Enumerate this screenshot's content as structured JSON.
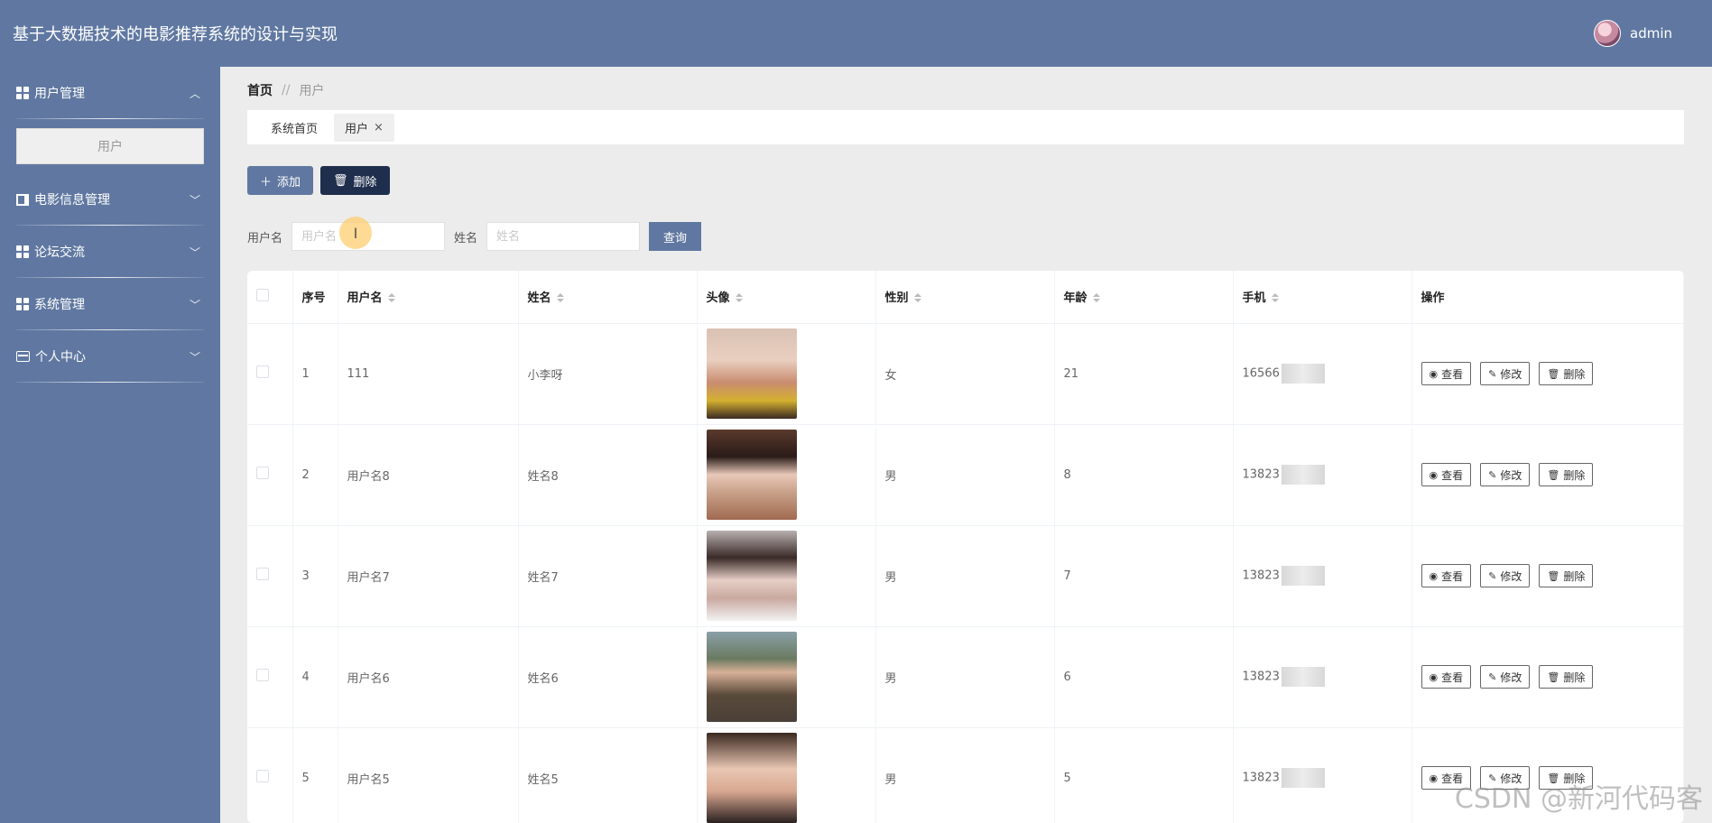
{
  "header": {
    "title": "基于大数据技术的电影推荐系统的设计与实现",
    "username": "admin"
  },
  "sidebar": {
    "items": [
      {
        "label": "用户管理",
        "icon": "grid-icon",
        "expanded": true,
        "children": [
          {
            "label": "用户"
          }
        ]
      },
      {
        "label": "电影信息管理",
        "icon": "book-icon",
        "expanded": false
      },
      {
        "label": "论坛交流",
        "icon": "grid-icon",
        "expanded": false
      },
      {
        "label": "系统管理",
        "icon": "grid-icon",
        "expanded": false
      },
      {
        "label": "个人中心",
        "icon": "card-icon",
        "expanded": false
      }
    ]
  },
  "breadcrumb": {
    "home": "首页",
    "separator": "//",
    "current": "用户"
  },
  "tabs": [
    {
      "label": "系统首页"
    },
    {
      "label": "用户",
      "close": "×"
    }
  ],
  "actions": {
    "add": "添加",
    "delete": "删除"
  },
  "search": {
    "username_label": "用户名",
    "username_placeholder": "用户名",
    "name_label": "姓名",
    "name_placeholder": "姓名",
    "query_label": "查询"
  },
  "table": {
    "headers": [
      "序号",
      "用户名",
      "姓名",
      "头像",
      "性别",
      "年龄",
      "手机",
      "操作"
    ],
    "rows": [
      {
        "no": "1",
        "username": "111",
        "name": "小李呀",
        "gender": "女",
        "age": "21",
        "phone": "16566"
      },
      {
        "no": "2",
        "username": "用户名8",
        "name": "姓名8",
        "gender": "男",
        "age": "8",
        "phone": "13823"
      },
      {
        "no": "3",
        "username": "用户名7",
        "name": "姓名7",
        "gender": "男",
        "age": "7",
        "phone": "13823"
      },
      {
        "no": "4",
        "username": "用户名6",
        "name": "姓名6",
        "gender": "男",
        "age": "6",
        "phone": "13823"
      },
      {
        "no": "5",
        "username": "用户名5",
        "name": "姓名5",
        "gender": "男",
        "age": "5",
        "phone": "13823"
      }
    ],
    "op_labels": {
      "view": "查看",
      "edit": "修改",
      "delete": "删除"
    }
  },
  "watermark": "CSDN @新河代码客",
  "colors": {
    "primary": "#6078a1",
    "dark": "#1f2e4d"
  }
}
